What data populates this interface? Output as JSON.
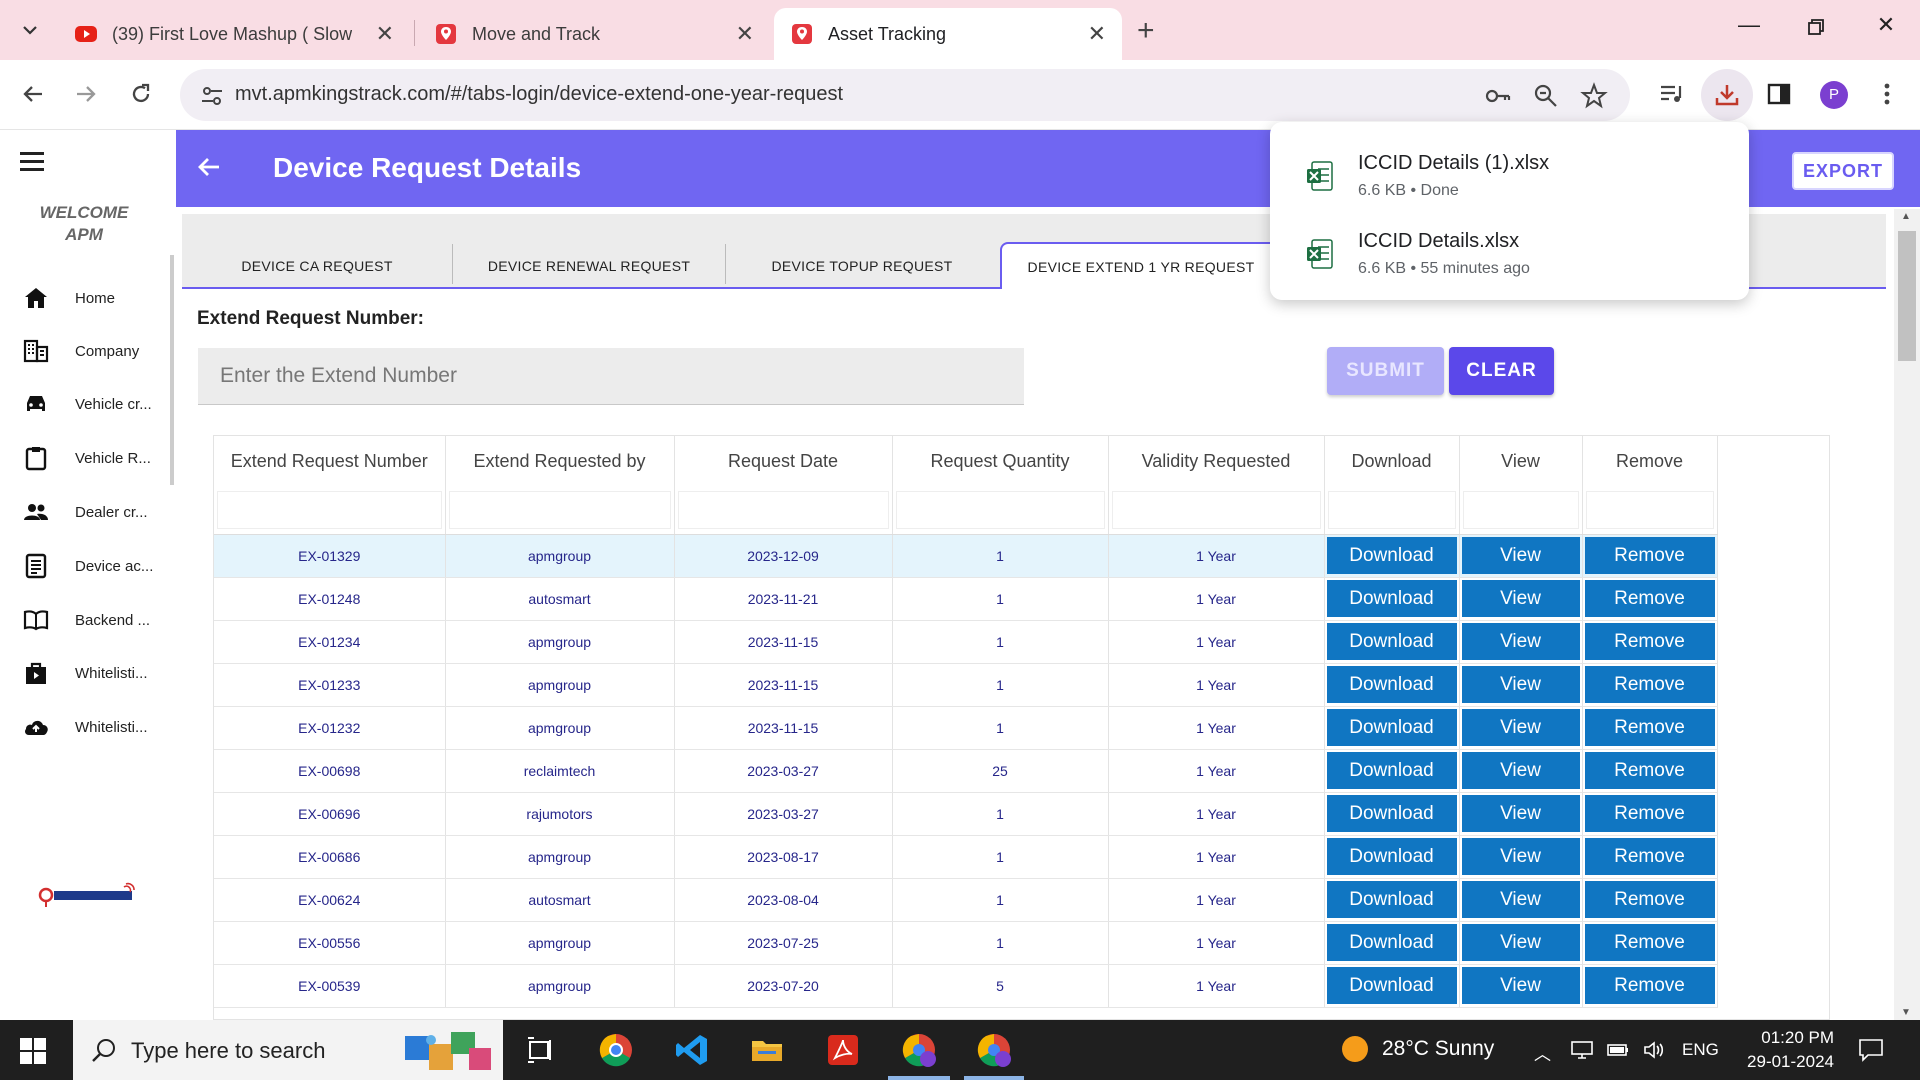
{
  "browser": {
    "tabs": [
      {
        "title": "(39) First Love Mashup ( Slowed",
        "active": false,
        "favicon": "youtube-icon"
      },
      {
        "title": "Move and Track",
        "active": false,
        "favicon": "location-pin-icon"
      },
      {
        "title": "Asset Tracking",
        "active": true,
        "favicon": "location-pin-icon"
      }
    ],
    "url": "mvt.apmkingstrack.com/#/tabs-login/device-extend-one-year-request",
    "profile_initial": "P"
  },
  "downloads": [
    {
      "name": "ICCID Details (1).xlsx",
      "meta": "6.6 KB • Done"
    },
    {
      "name": "ICCID Details.xlsx",
      "meta": "6.6 KB • 55 minutes ago"
    }
  ],
  "sidebar": {
    "welcome_line1": "WELCOME",
    "welcome_line2": "APM",
    "items": [
      {
        "label": "Home",
        "icon": "home-icon"
      },
      {
        "label": "Company",
        "icon": "building-icon"
      },
      {
        "label": "Vehicle cr...",
        "icon": "car-icon"
      },
      {
        "label": "Vehicle R...",
        "icon": "clipboard-icon"
      },
      {
        "label": "Dealer cr...",
        "icon": "people-icon"
      },
      {
        "label": "Device ac...",
        "icon": "document-icon"
      },
      {
        "label": "Backend ...",
        "icon": "book-icon"
      },
      {
        "label": "Whitelisti...",
        "icon": "shopping-bag-icon"
      },
      {
        "label": "Whitelisti...",
        "icon": "cloud-upload-icon"
      }
    ]
  },
  "header": {
    "title": "Device Request Details",
    "export_label": "EXPORT",
    "color": "#7066f2"
  },
  "request_tabs": [
    {
      "label": "DEVICE CA REQUEST",
      "active": false
    },
    {
      "label": "DEVICE RENEWAL REQUEST",
      "active": false
    },
    {
      "label": "DEVICE TOPUP REQUEST",
      "active": false
    },
    {
      "label": "DEVICE EXTEND 1 YR REQUEST",
      "active": true
    }
  ],
  "form": {
    "label": "Extend Request Number:",
    "placeholder": "Enter the Extend Number",
    "value": "",
    "submit_label": "SUBMIT",
    "clear_label": "CLEAR"
  },
  "table": {
    "columns": [
      "Extend Request Number",
      "Extend Requested by",
      "Request Date",
      "Request Quantity",
      "Validity Requested",
      "Download",
      "View",
      "Remove"
    ],
    "action_labels": {
      "download": "Download",
      "view": "View",
      "remove": "Remove"
    },
    "rows": [
      [
        "EX-01329",
        "apmgroup",
        "2023-12-09",
        "1",
        "1 Year"
      ],
      [
        "EX-01248",
        "autosmart",
        "2023-11-21",
        "1",
        "1 Year"
      ],
      [
        "EX-01234",
        "apmgroup",
        "2023-11-15",
        "1",
        "1 Year"
      ],
      [
        "EX-01233",
        "apmgroup",
        "2023-11-15",
        "1",
        "1 Year"
      ],
      [
        "EX-01232",
        "apmgroup",
        "2023-11-15",
        "1",
        "1 Year"
      ],
      [
        "EX-00698",
        "reclaimtech",
        "2023-03-27",
        "25",
        "1 Year"
      ],
      [
        "EX-00696",
        "rajumotors",
        "2023-03-27",
        "1",
        "1 Year"
      ],
      [
        "EX-00686",
        "apmgroup",
        "2023-08-17",
        "1",
        "1 Year"
      ],
      [
        "EX-00624",
        "autosmart",
        "2023-08-04",
        "1",
        "1 Year"
      ],
      [
        "EX-00556",
        "apmgroup",
        "2023-07-25",
        "1",
        "1 Year"
      ],
      [
        "EX-00539",
        "apmgroup",
        "2023-07-20",
        "5",
        "1 Year"
      ]
    ],
    "selected_row": 0
  },
  "taskbar": {
    "search_placeholder": "Type here to search",
    "weather": "28°C  Sunny",
    "language": "ENG",
    "time": "01:20 PM",
    "date": "29-01-2024"
  }
}
